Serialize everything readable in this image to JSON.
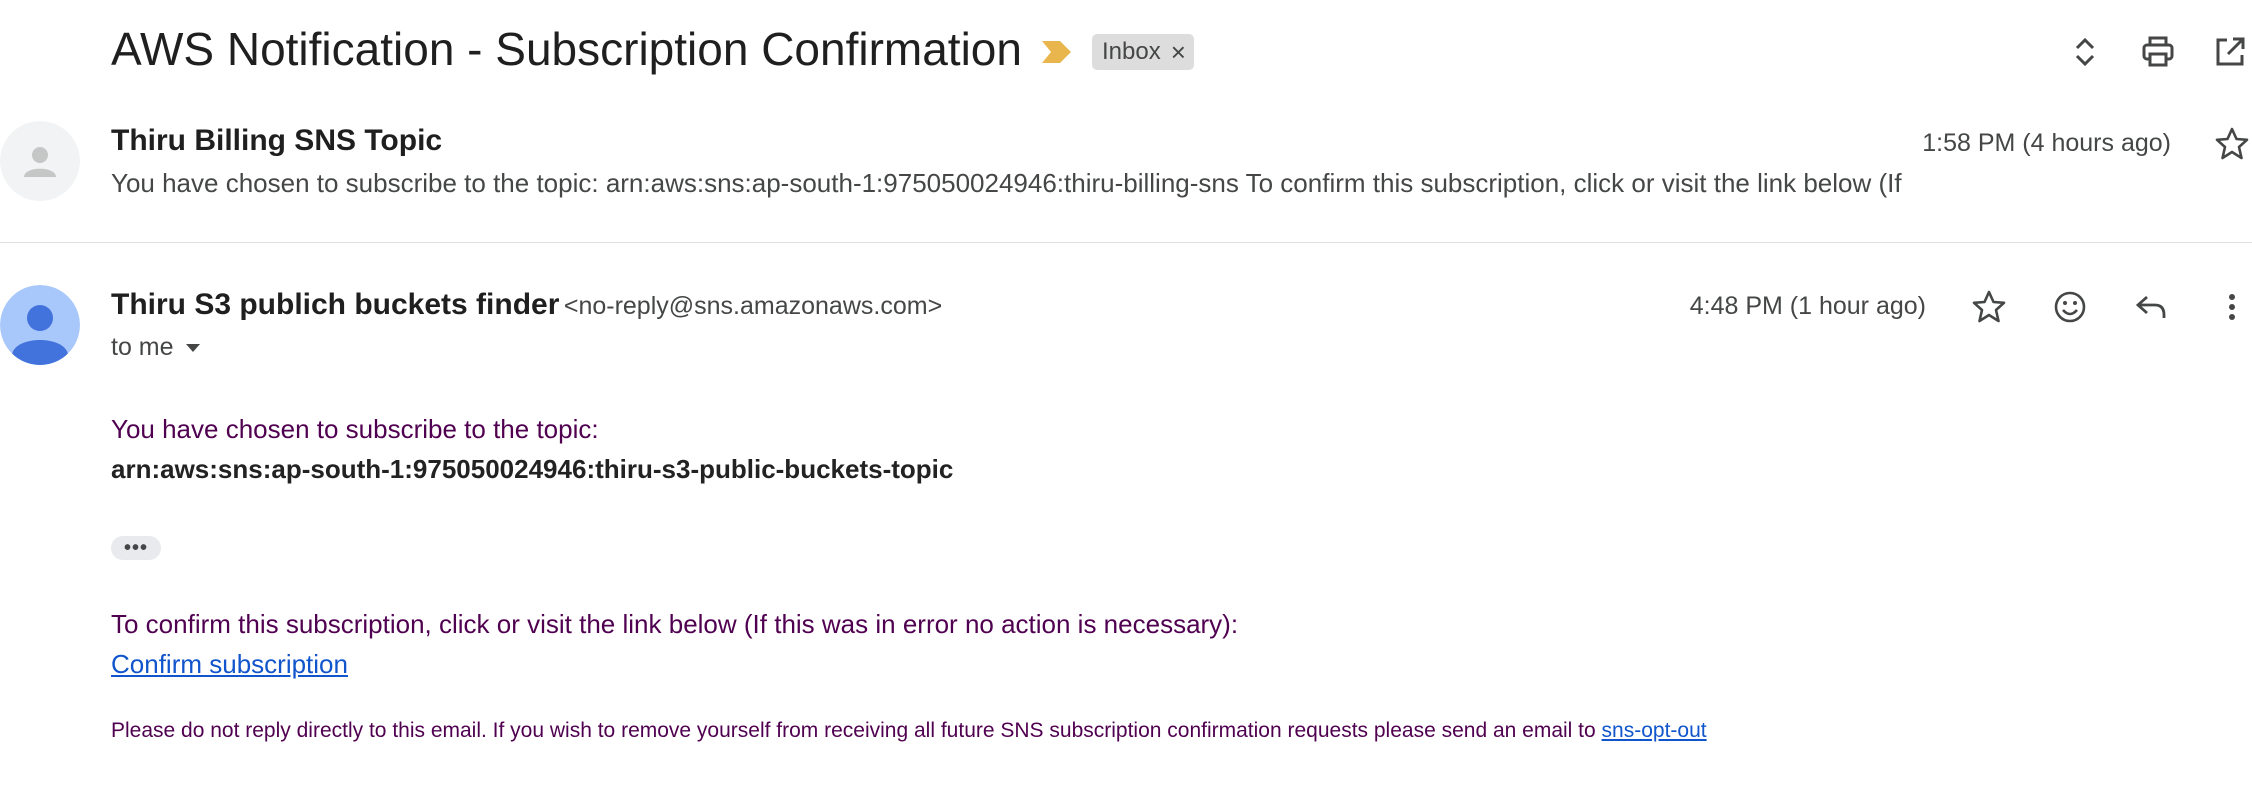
{
  "subject": "AWS Notification - Subscription Confirmation",
  "label": {
    "text": "Inbox",
    "remove": "×"
  },
  "colors": {
    "importance": "#e8b64c",
    "link": "#1155cc",
    "body_text": "#500050"
  },
  "collapsed_message": {
    "sender": "Thiru Billing SNS Topic",
    "time": "1:58 PM (4 hours ago)",
    "snippet": "You have chosen to subscribe to the topic: arn:aws:sns:ap-south-1:975050024946:thiru-billing-sns To confirm this subscription, click or visit the link below (If"
  },
  "expanded_message": {
    "sender": "Thiru S3 publich buckets finder",
    "email": "<no-reply@sns.amazonaws.com>",
    "time": "4:48 PM (1 hour ago)",
    "recipient": "to me",
    "intro": "You have chosen to subscribe to the topic:",
    "arn": "arn:aws:sns:ap-south-1:975050024946:thiru-s3-public-buckets-topic",
    "ellipsis": "•••",
    "confirm_text": "To confirm this subscription, click or visit the link below (If this was in error no action is necessary):",
    "confirm_link": "Confirm subscription",
    "footer": "Please do not reply directly to this email. If you wish to remove yourself from receiving all future SNS subscription confirmation requests please send an email to",
    "optout_link": "sns-opt-out"
  }
}
